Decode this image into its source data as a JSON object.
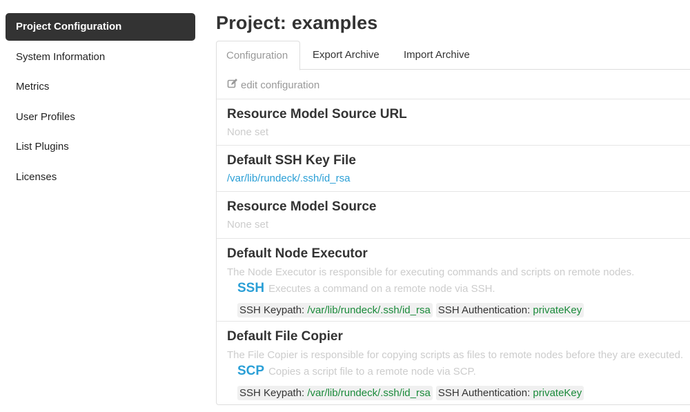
{
  "sidebar": {
    "items": [
      {
        "label": "Project Configuration",
        "active": true
      },
      {
        "label": "System Information"
      },
      {
        "label": "Metrics"
      },
      {
        "label": "User Profiles"
      },
      {
        "label": "List Plugins"
      },
      {
        "label": "Licenses"
      }
    ]
  },
  "page": {
    "title": "Project: examples"
  },
  "tabs": [
    {
      "label": "Configuration",
      "active": true
    },
    {
      "label": "Export Archive"
    },
    {
      "label": "Import Archive"
    }
  ],
  "edit": {
    "label": "edit configuration",
    "icon": "edit-icon"
  },
  "sections": {
    "resource_url": {
      "title": "Resource Model Source URL",
      "value": "None set"
    },
    "ssh_key": {
      "title": "Default SSH Key File",
      "value": "/var/lib/rundeck/.ssh/id_rsa"
    },
    "resource_source": {
      "title": "Resource Model Source",
      "value": "None set"
    },
    "node_executor": {
      "title": "Default Node Executor",
      "description": "The Node Executor is responsible for executing commands and scripts on remote nodes.",
      "plugin_name": "SSH",
      "plugin_desc": "Executes a command on a remote node via SSH.",
      "keypath_label": "SSH Keypath: ",
      "keypath_value": "/var/lib/rundeck/.ssh/id_rsa",
      "auth_label": "SSH Authentication: ",
      "auth_value": "privateKey"
    },
    "file_copier": {
      "title": "Default File Copier",
      "description": "The File Copier is responsible for copying scripts as files to remote nodes before they are executed.",
      "plugin_name": "SCP",
      "plugin_desc": "Copies a script file to a remote node via SCP.",
      "keypath_label": "SSH Keypath: ",
      "keypath_value": "/var/lib/rundeck/.ssh/id_rsa",
      "auth_label": "SSH Authentication: ",
      "auth_value": "privateKey"
    }
  },
  "colors": {
    "accent": "#2a9fd6",
    "active_nav_bg": "#333333",
    "muted_text": "#cccccc",
    "value_green": "#1a8a3a"
  }
}
